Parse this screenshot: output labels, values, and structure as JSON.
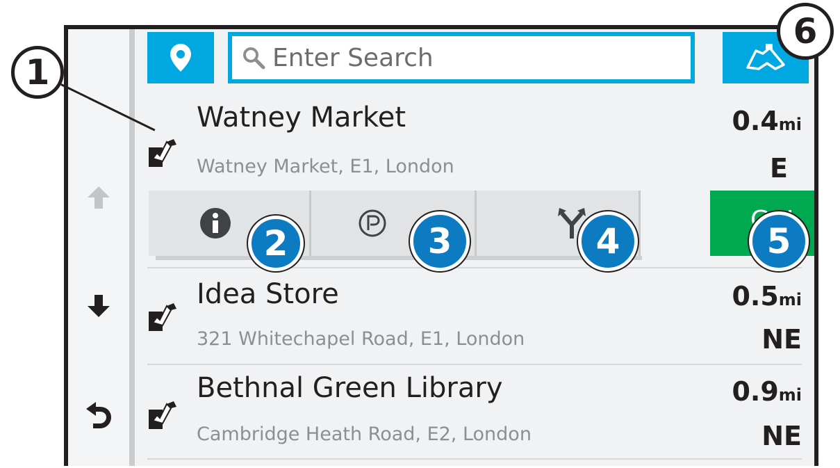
{
  "search": {
    "placeholder": "Enter Search"
  },
  "icons": {
    "location": "map-pin-icon",
    "map": "map-view-icon",
    "search": "search-icon",
    "up": "arrow-up-icon",
    "down": "arrow-down-icon",
    "back": "back-icon",
    "info": "info-icon",
    "parking": "parking-icon",
    "route": "route-fork-icon",
    "poi": "poi-category-icon"
  },
  "results": [
    {
      "name": "Watney Market",
      "address": "Watney Market, E1, London",
      "distance": "0.4",
      "unit": "mi",
      "direction": "E"
    },
    {
      "name": "Idea Store",
      "address": "321 Whitechapel Road, E1, London",
      "distance": "0.5",
      "unit": "mi",
      "direction": "NE"
    },
    {
      "name": "Bethnal Green Library",
      "address": "Cambridge Heath Road, E2, London",
      "distance": "0.9",
      "unit": "mi",
      "direction": "NE"
    }
  ],
  "actions": {
    "go_label": "Go!"
  },
  "callouts": [
    "1",
    "2",
    "3",
    "4",
    "5",
    "6"
  ],
  "colors": {
    "accent": "#00a7e1",
    "go": "#00a84f",
    "callout": "#0c7bc1"
  }
}
